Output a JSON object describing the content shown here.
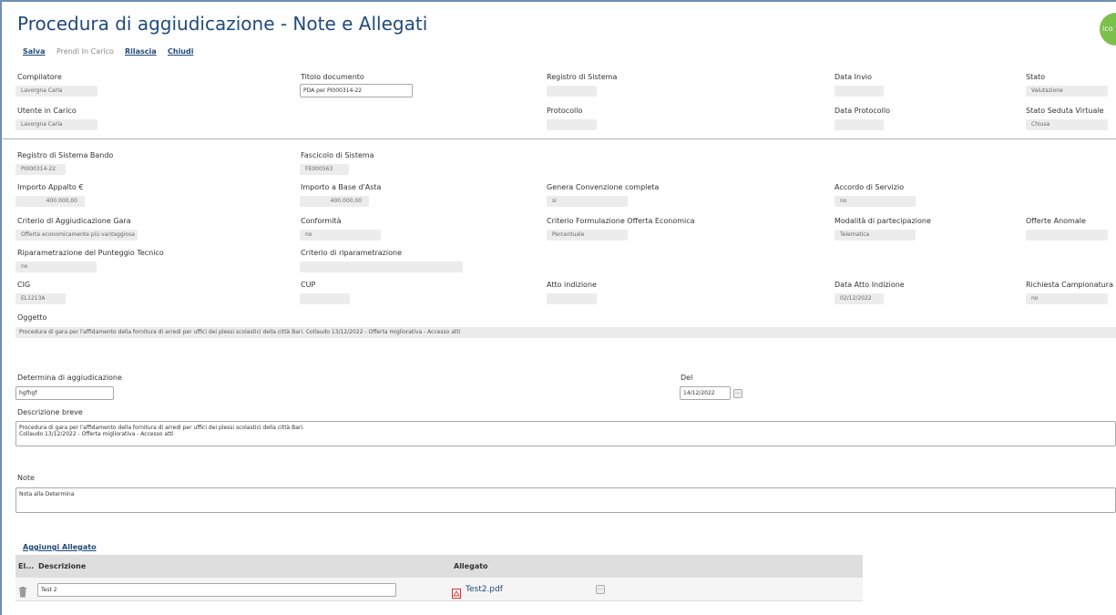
{
  "page": {
    "title": "Procedura di aggiudicazione - Note e Allegati",
    "badge": "ico"
  },
  "toolbar": {
    "save": "Salva",
    "take": "Prendi In Carico",
    "release": "Rilascia",
    "close": "Chiudi"
  },
  "header": {
    "compilatore": {
      "label": "Compilatore",
      "value": "Lavorgna Carla"
    },
    "titolo": {
      "label": "Titolo documento",
      "value": "PDA per PI000314-22"
    },
    "registro": {
      "label": "Registro di Sistema",
      "value": ""
    },
    "data_invio": {
      "label": "Data Invio",
      "value": ""
    },
    "stato": {
      "label": "Stato",
      "value": "Valutazione"
    },
    "utente": {
      "label": "Utente in Carico",
      "value": "Lavorgna Carla"
    },
    "protocollo": {
      "label": "Protocollo",
      "value": ""
    },
    "data_protocollo": {
      "label": "Data Protocollo",
      "value": ""
    },
    "stato_seduta": {
      "label": "Stato Seduta Virtuale",
      "value": "Chiusa"
    }
  },
  "details": {
    "registro_bando": {
      "label": "Registro di Sistema Bando",
      "value": "PI000314-22"
    },
    "fascicolo": {
      "label": "Fascicolo di Sistema",
      "value": "FE000563"
    },
    "importo_appalto": {
      "label": "Importo Appalto €",
      "value": "400.000,00"
    },
    "importo_base": {
      "label": "Importo a Base d'Asta",
      "value": "400.000,00"
    },
    "genera_convenzione": {
      "label": "Genera Convenzione completa",
      "value": "si"
    },
    "accordo_servizio": {
      "label": "Accordo di Servizio",
      "value": "no"
    },
    "criterio_aggiudicazione": {
      "label": "Criterio di Aggiudicazione Gara",
      "value": "Offerta economicamente più vantaggiosa"
    },
    "conformita": {
      "label": "Conformità",
      "value": "no"
    },
    "criterio_formulazione": {
      "label": "Criterio Formulazione Offerta Economica",
      "value": "Percentuale"
    },
    "modalita": {
      "label": "Modalità di partecipazione",
      "value": "Telematica"
    },
    "offerte_anomale": {
      "label": "Offerte Anomale",
      "value": ""
    },
    "riparametrazione": {
      "label": "Riparametrazione del Punteggio Tecnico",
      "value": "no"
    },
    "criterio_riparametrazione": {
      "label": "Criterio di riparametrazione",
      "value": ""
    },
    "cig": {
      "label": "CIG",
      "value": "EL1213A"
    },
    "cup": {
      "label": "CUP",
      "value": ""
    },
    "atto_indizione": {
      "label": "Atto indizione",
      "value": ""
    },
    "data_atto": {
      "label": "Data Atto Indizione",
      "value": "02/12/2022"
    },
    "campionatura": {
      "label": "Richiesta Campionatura",
      "value": "no"
    },
    "oggetto": {
      "label": "Oggetto",
      "value": "Procedura di gara per l'affidamento della fornitura di arredi per uffici dei plessi scolastici della città Bari. Collaudo 13/12/2022 - Offerta migliorativa - Accesso atti"
    }
  },
  "determina": {
    "label": "Determina di aggiudicazione",
    "value": "hgfhgf",
    "del_label": "Del",
    "del_value": "14/12/2022",
    "picker": "...",
    "descr_label": "Descrizione breve",
    "descr_value": "Procedura di gara per l'affidamento della fornitura di arredi per uffici dei plessi scolastici della città Bari.\nCollaudo 13/12/2022 - Offerta migliorativa - Accesso atti",
    "note_label": "Note",
    "note_value": "Nota alla Determina"
  },
  "allegati": {
    "add_label": "Aggiungi Allegato",
    "columns": {
      "el": "El...",
      "descrizione": "Descrizione",
      "allegato": "Allegato"
    },
    "rows": [
      {
        "descrizione": "Test 2",
        "file": "Test2.pdf",
        "picker": "..."
      }
    ]
  },
  "colors": {
    "title": "#1f4a7a",
    "readonly_bg": "#ececec",
    "table_header": "#dedede",
    "badge": "#7ac04a",
    "pdf": "#d9302c"
  },
  "icons": {
    "delete": "trash-icon",
    "file": "pdf-file-icon"
  }
}
